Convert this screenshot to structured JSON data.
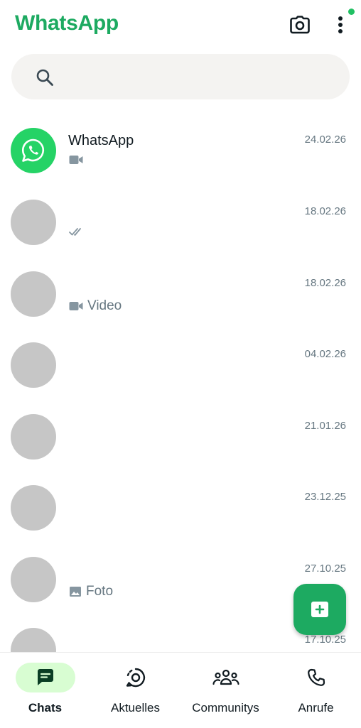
{
  "header": {
    "title": "WhatsApp",
    "icons": [
      "camera-icon",
      "more-vert-icon"
    ]
  },
  "search": {
    "placeholder": ""
  },
  "chats": [
    {
      "name": "WhatsApp",
      "time": "24.02.26",
      "preview_icon": "video-icon",
      "preview_text": ""
    },
    {
      "name": "",
      "time": "18.02.26",
      "preview_icon": "double-check-icon",
      "preview_text": ""
    },
    {
      "name": "",
      "time": "18.02.26",
      "preview_icon": "video-icon",
      "preview_text": "Video"
    },
    {
      "name": "",
      "time": "04.02.26",
      "preview_icon": "",
      "preview_text": ""
    },
    {
      "name": "",
      "time": "21.01.26",
      "preview_icon": "",
      "preview_text": ""
    },
    {
      "name": "",
      "time": "23.12.25",
      "preview_icon": "",
      "preview_text": ""
    },
    {
      "name": "",
      "time": "27.10.25",
      "preview_icon": "image-icon",
      "preview_text": "Foto"
    },
    {
      "name": "",
      "time": "17.10.25",
      "preview_icon": "",
      "preview_text": ""
    }
  ],
  "nav": [
    {
      "label": "Chats",
      "active": true
    },
    {
      "label": "Aktuelles",
      "active": false
    },
    {
      "label": "Communitys",
      "active": false
    },
    {
      "label": "Anrufe",
      "active": false
    }
  ],
  "colors": {
    "brand": "#1daa61",
    "active_pill": "#d8fdd2",
    "status_dot": "#21c063"
  }
}
